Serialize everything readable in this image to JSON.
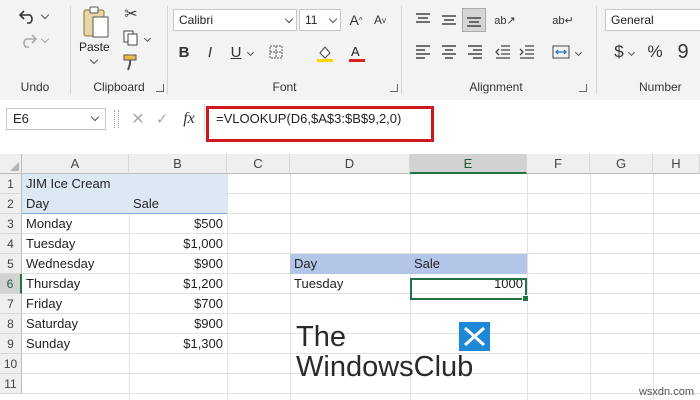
{
  "ribbon": {
    "undo": {
      "label": "Undo"
    },
    "clipboard": {
      "label": "Clipboard",
      "paste_label": "Paste"
    },
    "font": {
      "label": "Font",
      "font_name": "Calibri",
      "font_size": "11"
    },
    "alignment": {
      "label": "Alignment"
    },
    "number": {
      "label": "Number",
      "format": "General"
    }
  },
  "formula_bar": {
    "name_box": "E6",
    "fx_symbol": "fx",
    "formula": "=VLOOKUP(D6,$A$3:$B$9,2,0)"
  },
  "grid": {
    "columns": [
      "A",
      "B",
      "C",
      "D",
      "E",
      "F",
      "G",
      "H"
    ],
    "rows": [
      "1",
      "2",
      "3",
      "4",
      "5",
      "6",
      "7",
      "8",
      "9",
      "10",
      "11"
    ],
    "table": {
      "title": "JIM Ice Cream",
      "headers": [
        "Day",
        "Sale"
      ],
      "rows": [
        [
          "Monday",
          "$500"
        ],
        [
          "Tuesday",
          "$1,000"
        ],
        [
          "Wednesday",
          "$900"
        ],
        [
          "Thursday",
          "$1,200"
        ],
        [
          "Friday",
          "$700"
        ],
        [
          "Saturday",
          "$900"
        ],
        [
          "Sunday",
          "$1,300"
        ]
      ]
    },
    "lookup": {
      "headers": [
        "Day",
        "Sale"
      ],
      "day": "Tuesday",
      "result": "1000"
    }
  },
  "watermark": {
    "line1": "The",
    "line2": "WindowsClub"
  },
  "source": "wsxdn.com",
  "colors": {
    "accent": "#217346",
    "highlight_box": "#d0191c",
    "table_fill": "#dce9f5",
    "lookup_header_fill": "#b4c6e7"
  }
}
